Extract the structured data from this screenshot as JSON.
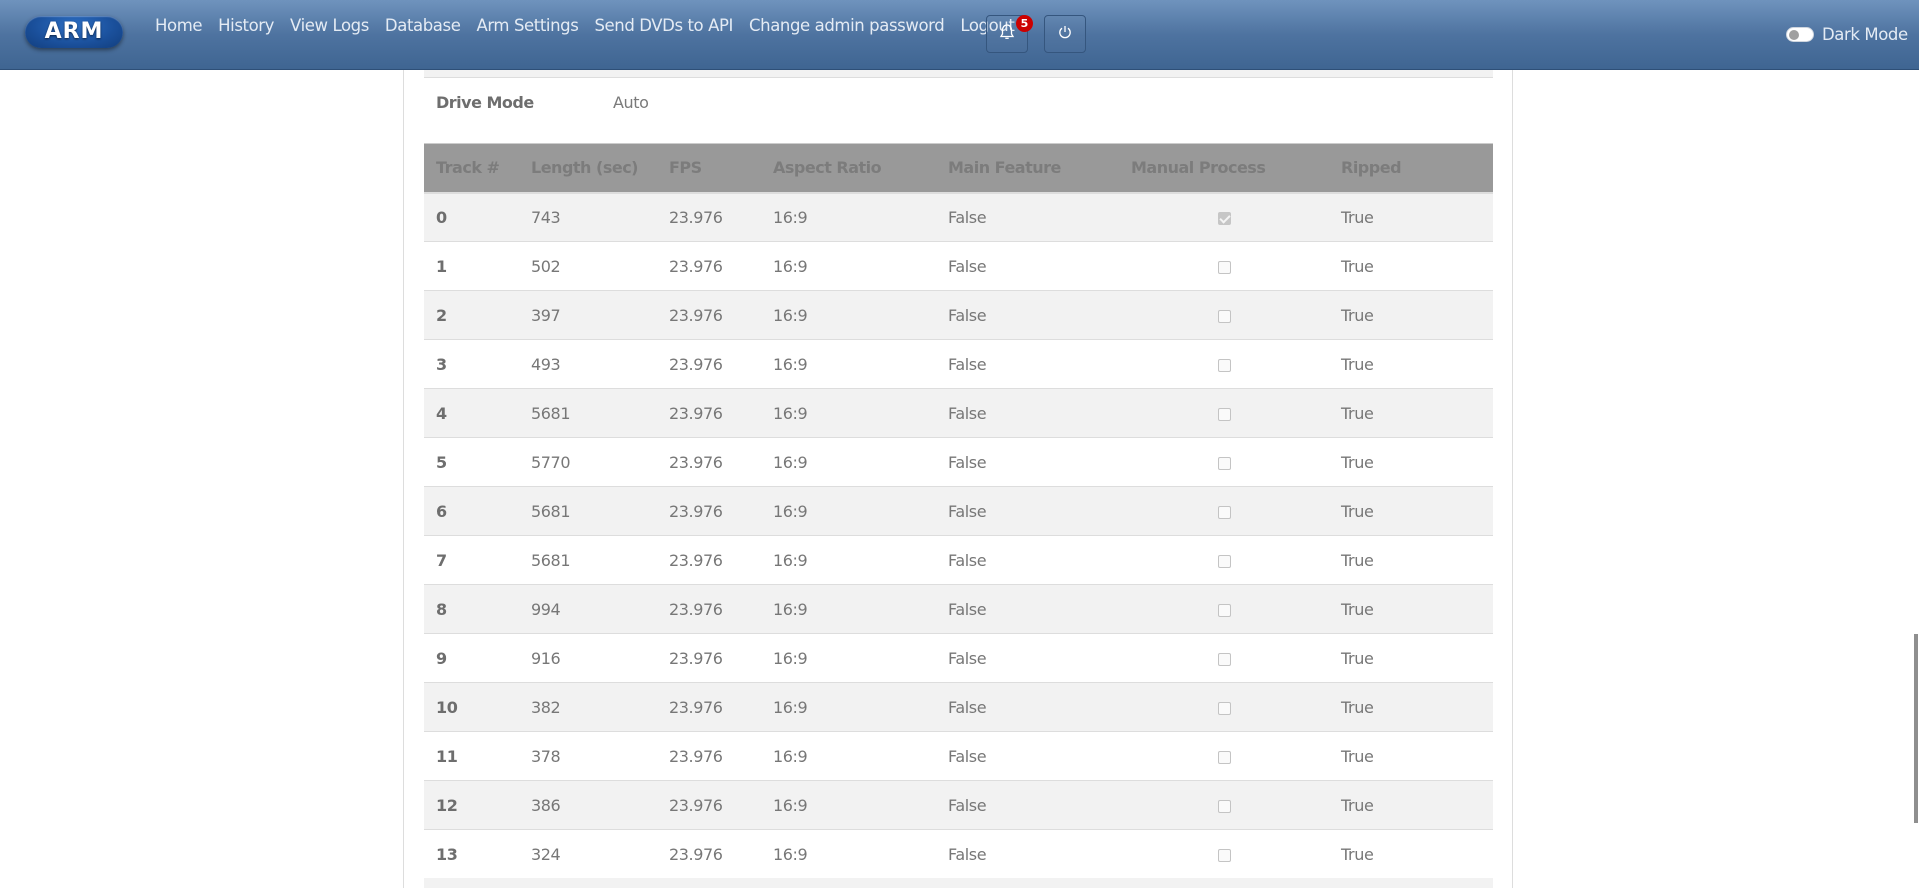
{
  "navbar": {
    "logo_text": "ARM",
    "links": [
      "Home",
      "History",
      "View Logs",
      "Database",
      "Arm Settings",
      "Send DVDs to API",
      "Change admin password",
      "Logout"
    ],
    "notification_count": "5",
    "notifications_icon": "bell-icon",
    "power_icon": "power-icon",
    "dark_mode_label": "Dark Mode",
    "dark_mode_enabled": false
  },
  "drive": {
    "label": "Drive Mode",
    "value": "Auto"
  },
  "tracks_table": {
    "headers": [
      "Track #",
      "Length (sec)",
      "FPS",
      "Aspect Ratio",
      "Main Feature",
      "Manual Process",
      "Ripped"
    ],
    "rows": [
      {
        "track": "0",
        "length": "743",
        "fps": "23.976",
        "aspect": "16:9",
        "main_feature": "False",
        "manual_process": true,
        "ripped": "True"
      },
      {
        "track": "1",
        "length": "502",
        "fps": "23.976",
        "aspect": "16:9",
        "main_feature": "False",
        "manual_process": false,
        "ripped": "True"
      },
      {
        "track": "2",
        "length": "397",
        "fps": "23.976",
        "aspect": "16:9",
        "main_feature": "False",
        "manual_process": false,
        "ripped": "True"
      },
      {
        "track": "3",
        "length": "493",
        "fps": "23.976",
        "aspect": "16:9",
        "main_feature": "False",
        "manual_process": false,
        "ripped": "True"
      },
      {
        "track": "4",
        "length": "5681",
        "fps": "23.976",
        "aspect": "16:9",
        "main_feature": "False",
        "manual_process": false,
        "ripped": "True"
      },
      {
        "track": "5",
        "length": "5770",
        "fps": "23.976",
        "aspect": "16:9",
        "main_feature": "False",
        "manual_process": false,
        "ripped": "True"
      },
      {
        "track": "6",
        "length": "5681",
        "fps": "23.976",
        "aspect": "16:9",
        "main_feature": "False",
        "manual_process": false,
        "ripped": "True"
      },
      {
        "track": "7",
        "length": "5681",
        "fps": "23.976",
        "aspect": "16:9",
        "main_feature": "False",
        "manual_process": false,
        "ripped": "True"
      },
      {
        "track": "8",
        "length": "994",
        "fps": "23.976",
        "aspect": "16:9",
        "main_feature": "False",
        "manual_process": false,
        "ripped": "True"
      },
      {
        "track": "9",
        "length": "916",
        "fps": "23.976",
        "aspect": "16:9",
        "main_feature": "False",
        "manual_process": false,
        "ripped": "True"
      },
      {
        "track": "10",
        "length": "382",
        "fps": "23.976",
        "aspect": "16:9",
        "main_feature": "False",
        "manual_process": false,
        "ripped": "True"
      },
      {
        "track": "11",
        "length": "378",
        "fps": "23.976",
        "aspect": "16:9",
        "main_feature": "False",
        "manual_process": false,
        "ripped": "True"
      },
      {
        "track": "12",
        "length": "386",
        "fps": "23.976",
        "aspect": "16:9",
        "main_feature": "False",
        "manual_process": false,
        "ripped": "True"
      },
      {
        "track": "13",
        "length": "324",
        "fps": "23.976",
        "aspect": "16:9",
        "main_feature": "False",
        "manual_process": false,
        "ripped": "True"
      }
    ]
  }
}
